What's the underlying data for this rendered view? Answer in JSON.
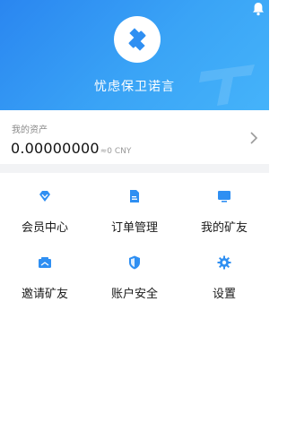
{
  "header": {
    "brand_name": "忧虑保卫诺言",
    "bell_icon": "bell-icon",
    "logo_icon": "logo-icon",
    "accent": "#2f8ff2"
  },
  "assets": {
    "label": "我的资产",
    "amount": "0.00000000",
    "cny": "≈0 CNY",
    "chevron_icon": "chevron-right-icon"
  },
  "menu": {
    "items": [
      {
        "label": "会员中心",
        "icon": "diamond-icon"
      },
      {
        "label": "订单管理",
        "icon": "document-icon"
      },
      {
        "label": "我的矿友",
        "icon": "monitor-icon"
      },
      {
        "label": "邀请矿友",
        "icon": "invite-card-icon"
      },
      {
        "label": "账户安全",
        "icon": "shield-icon"
      },
      {
        "label": "设置",
        "icon": "gear-icon"
      }
    ],
    "icon_color": "#2f8ff2"
  }
}
